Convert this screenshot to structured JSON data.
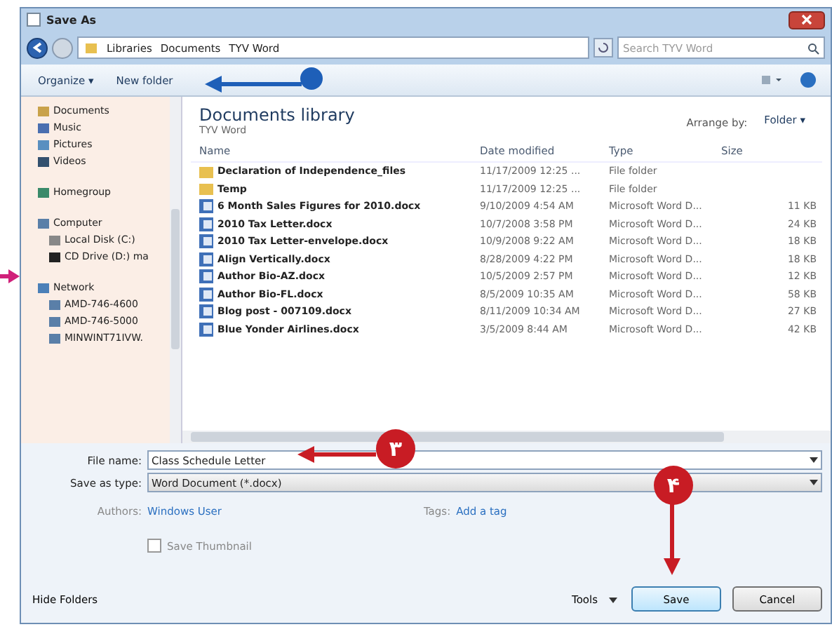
{
  "window": {
    "title": "Save As"
  },
  "address": {
    "crumbs": [
      "Libraries",
      "Documents",
      "TYV Word"
    ],
    "search_placeholder": "Search TYV Word"
  },
  "toolbar": {
    "organize": "Organize ▾",
    "new_folder": "New folder"
  },
  "nav": [
    {
      "label": "Documents",
      "kind": "docs"
    },
    {
      "label": "Music",
      "kind": "music"
    },
    {
      "label": "Pictures",
      "kind": "pictures"
    },
    {
      "label": "Videos",
      "kind": "videos"
    },
    {
      "label": "Homegroup",
      "kind": "homegroup"
    },
    {
      "label": "Computer",
      "kind": "computer",
      "children": [
        {
          "label": "Local Disk (C:)",
          "kind": "disk"
        },
        {
          "label": "CD Drive (D:) ma",
          "kind": "cd"
        }
      ]
    },
    {
      "label": "Network",
      "kind": "network",
      "children": [
        {
          "label": "AMD-746-4600",
          "kind": "pc"
        },
        {
          "label": "AMD-746-5000",
          "kind": "pc"
        },
        {
          "label": "MINWINT71IVW.",
          "kind": "pc"
        }
      ]
    }
  ],
  "library": {
    "title": "Documents library",
    "subtitle": "TYV Word",
    "arrange_label": "Arrange by:",
    "arrange_value": "Folder ▾"
  },
  "table": {
    "columns": [
      "Name",
      "Date modified",
      "Type",
      "Size"
    ],
    "rows": [
      {
        "kind": "folder",
        "name": "Declaration of Independence_files",
        "date": "11/17/2009 12:25 ...",
        "type": "File folder",
        "size": ""
      },
      {
        "kind": "folder",
        "name": "Temp",
        "date": "11/17/2009 12:25 ...",
        "type": "File folder",
        "size": ""
      },
      {
        "kind": "doc",
        "name": "6 Month Sales Figures for 2010.docx",
        "date": "9/10/2009 4:54 AM",
        "type": "Microsoft Word D...",
        "size": "11 KB"
      },
      {
        "kind": "doc",
        "name": "2010 Tax Letter.docx",
        "date": "10/7/2008 3:58 PM",
        "type": "Microsoft Word D...",
        "size": "24 KB"
      },
      {
        "kind": "doc",
        "name": "2010 Tax Letter-envelope.docx",
        "date": "10/9/2008 9:22 AM",
        "type": "Microsoft Word D...",
        "size": "18 KB"
      },
      {
        "kind": "doc",
        "name": "Align Vertically.docx",
        "date": "8/28/2009 4:22 PM",
        "type": "Microsoft Word D...",
        "size": "18 KB"
      },
      {
        "kind": "doc",
        "name": "Author Bio-AZ.docx",
        "date": "10/5/2009 2:57 PM",
        "type": "Microsoft Word D...",
        "size": "12 KB"
      },
      {
        "kind": "doc",
        "name": "Author Bio-FL.docx",
        "date": "8/5/2009 10:35 AM",
        "type": "Microsoft Word D...",
        "size": "58 KB"
      },
      {
        "kind": "doc",
        "name": "Blog post - 007109.docx",
        "date": "8/11/2009 10:34 AM",
        "type": "Microsoft Word D...",
        "size": "27 KB"
      },
      {
        "kind": "doc",
        "name": "Blue Yonder Airlines.docx",
        "date": "3/5/2009 8:44 AM",
        "type": "Microsoft Word D...",
        "size": "42 KB"
      }
    ]
  },
  "form": {
    "file_name_label": "File name:",
    "file_name": "Class Schedule Letter",
    "type_label": "Save as type:",
    "type_value": "Word Document (*.docx)",
    "authors_label": "Authors:",
    "authors": "Windows User",
    "tags_label": "Tags:",
    "tags": "Add a tag",
    "thumbnail": {
      "label": "Save Thumbnail",
      "checked": false
    }
  },
  "footer": {
    "hide_folders": "Hide Folders",
    "tools": "Tools",
    "save": "Save",
    "cancel": "Cancel"
  },
  "callouts": [
    {
      "kind": "number",
      "label": "۳"
    },
    {
      "kind": "number",
      "label": "۴"
    }
  ]
}
